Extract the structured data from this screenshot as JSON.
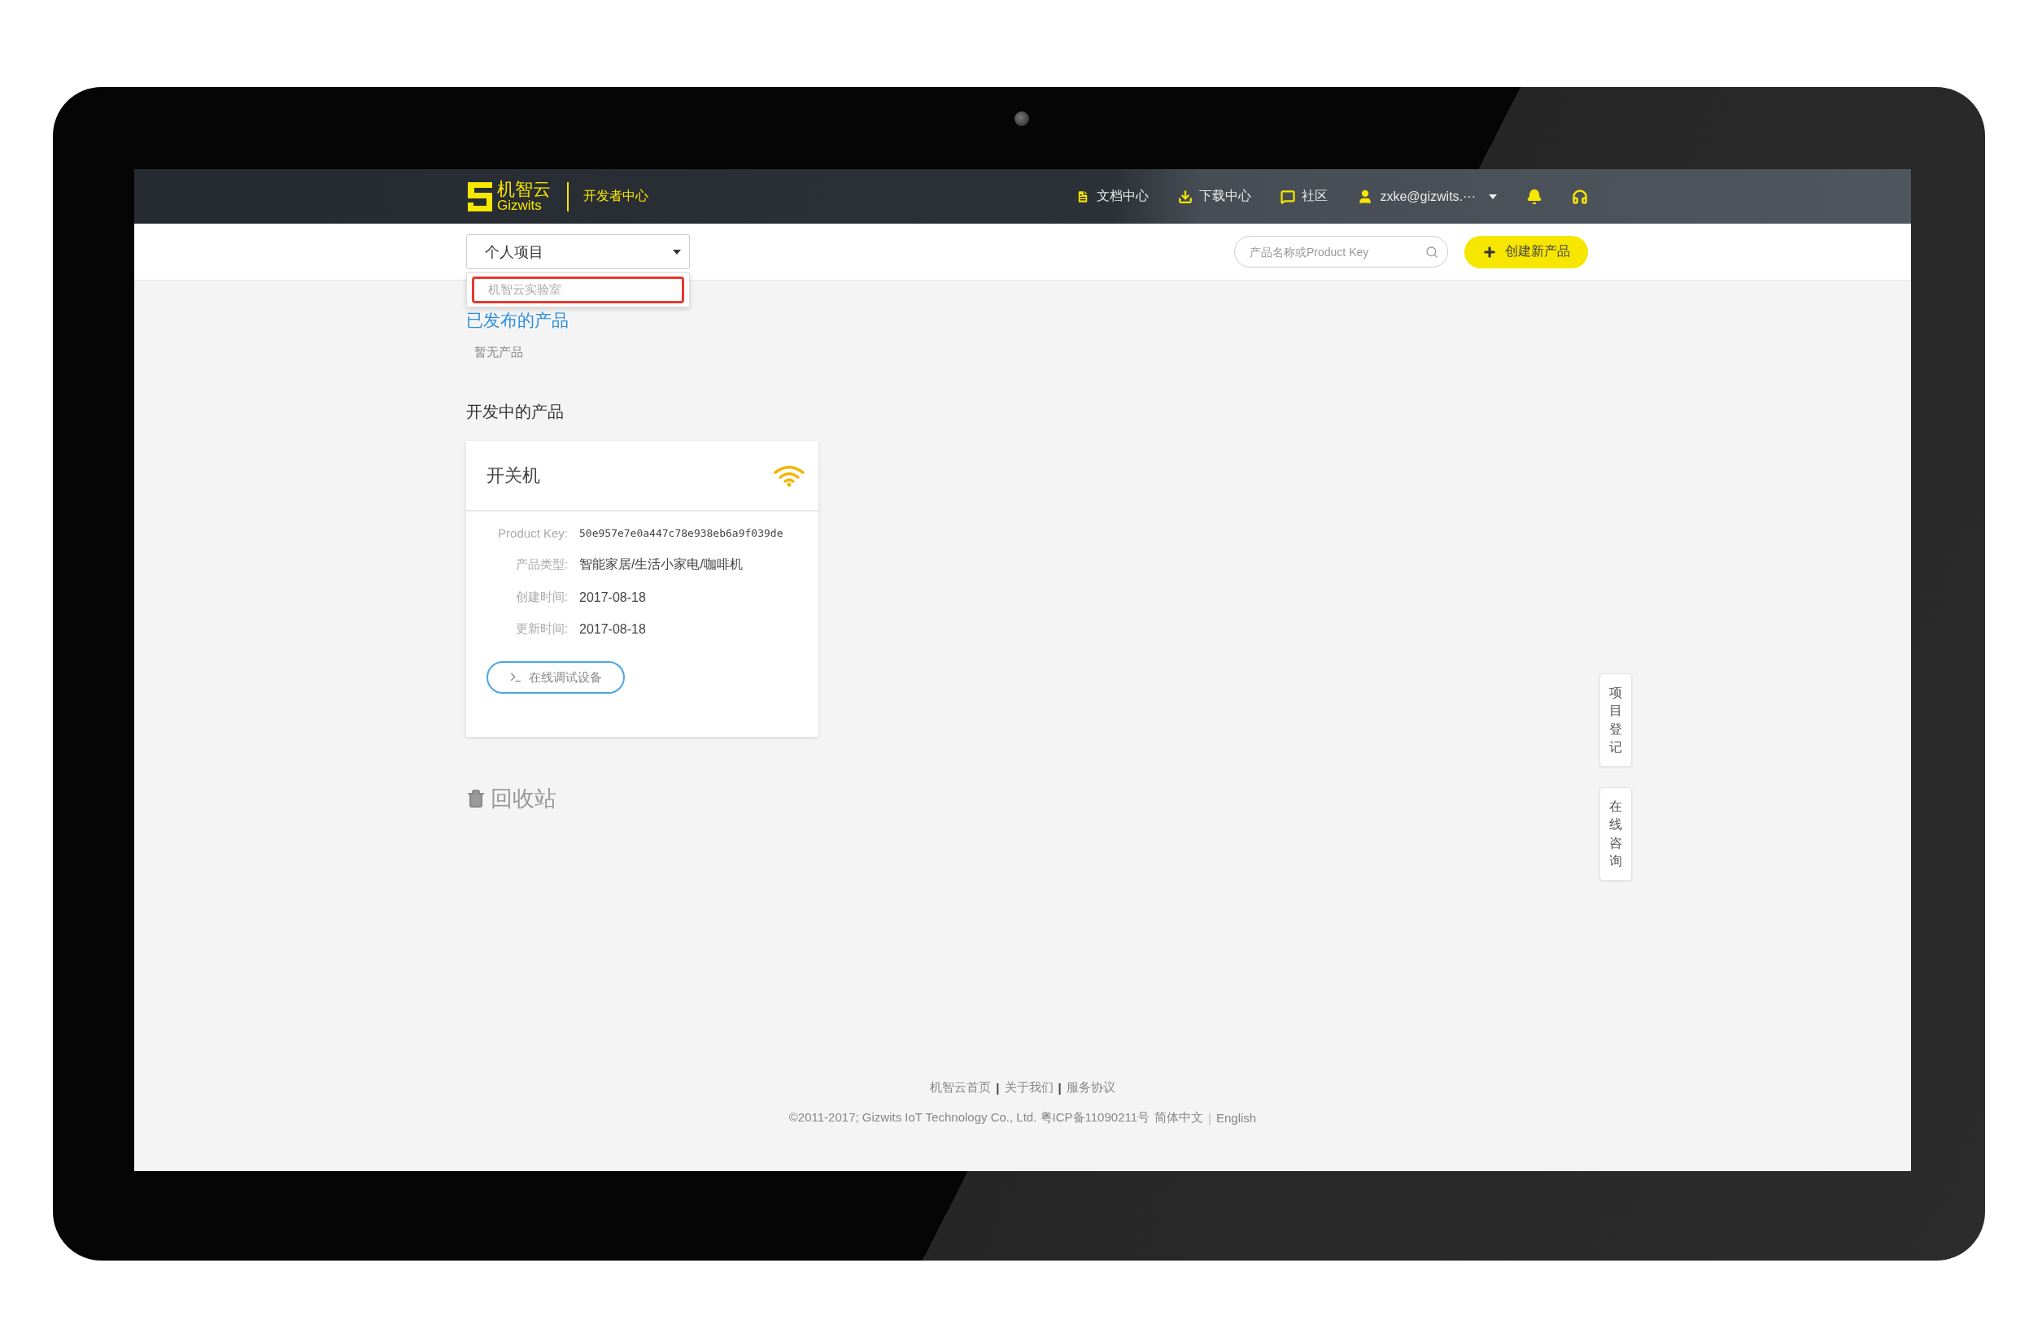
{
  "header": {
    "logo": {
      "name": "机智云",
      "sub": "Gizwits"
    },
    "portal": "开发者中心",
    "nav": [
      {
        "kind": "docs",
        "label": "文档中心"
      },
      {
        "kind": "download",
        "label": "下载中心"
      },
      {
        "kind": "community",
        "label": "社区"
      }
    ],
    "user": "zxke@gizwits.···"
  },
  "toolbar": {
    "project_select": {
      "value": "个人项目",
      "options": [
        {
          "label": "机智云实验室",
          "outlined": true
        }
      ]
    },
    "search": {
      "placeholder": "产品名称或Product Key"
    },
    "create_button": "创建新产品"
  },
  "published": {
    "title": "已发布的产品",
    "empty": "暂无产品"
  },
  "developing": {
    "title": "开发中的产品",
    "products": [
      {
        "name": "开关机",
        "fields": [
          {
            "kind": "mono",
            "label": "Product Key:",
            "value": "50e957e7e0a447c78e938eb6a9f039de"
          },
          {
            "kind": "text",
            "label": "产品类型:",
            "value": "智能家居/生活小家电/咖啡机"
          },
          {
            "kind": "text",
            "label": "创建时间:",
            "value": "2017-08-18"
          },
          {
            "kind": "text",
            "label": "更新时间:",
            "value": "2017-08-18"
          }
        ],
        "action": "在线调试设备"
      }
    ]
  },
  "recycle": "回收站",
  "side_buttons": [
    "项目登记",
    "在线咨询"
  ],
  "footer": {
    "links": [
      {
        "kind": "link",
        "text": "机智云首页"
      },
      {
        "kind": "separator",
        "text": "|"
      },
      {
        "kind": "link",
        "text": "关于我们"
      },
      {
        "kind": "separator",
        "text": "|"
      },
      {
        "kind": "link",
        "text": "服务协议"
      }
    ],
    "copyright": "©2011-2017; Gizwits IoT Technology Co., Ltd. 粤ICP备11090211号",
    "languages": [
      {
        "kind": "link",
        "text": "简体中文"
      },
      {
        "kind": "separator",
        "text": "|"
      },
      {
        "kind": "link",
        "text": "English"
      }
    ]
  }
}
